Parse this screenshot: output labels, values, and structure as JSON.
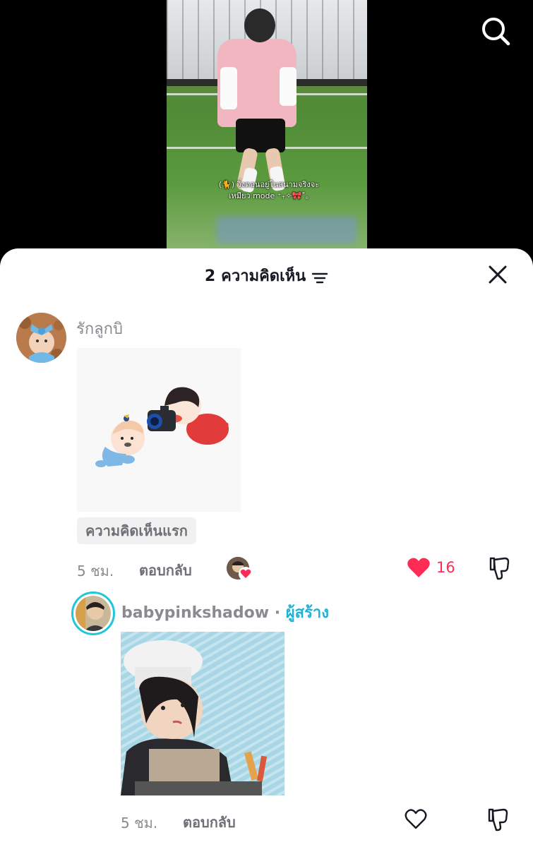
{
  "video": {
    "caption_line1": "(🐈) วิ่งตอนอยู่ในสนามจริงจะ",
    "caption_line2": "เหมียว mode ⁺₊✧🎀˚｡"
  },
  "header": {
    "count": "2",
    "title": "ความคิดเห็น"
  },
  "comments": [
    {
      "username": "รักลูกบิ",
      "badge": "ความคิดเห็นแรก",
      "time": "5 ชม.",
      "reply_label": "ตอบกลับ",
      "likes": "16",
      "liked": true
    },
    {
      "username": "babypinkshadow",
      "separator": " · ",
      "creator_label": "ผู้สร้าง",
      "time": "5 ชม.",
      "reply_label": "ตอบกลับ",
      "liked": false
    }
  ],
  "colors": {
    "like_active": "#fe2c55",
    "creator": "#20b2d6",
    "sheet_bg": "#ffffff",
    "text_secondary": "#8a8b91"
  },
  "icons": [
    "search-icon",
    "filter-icon",
    "close-icon",
    "heart-icon",
    "dislike-icon"
  ]
}
